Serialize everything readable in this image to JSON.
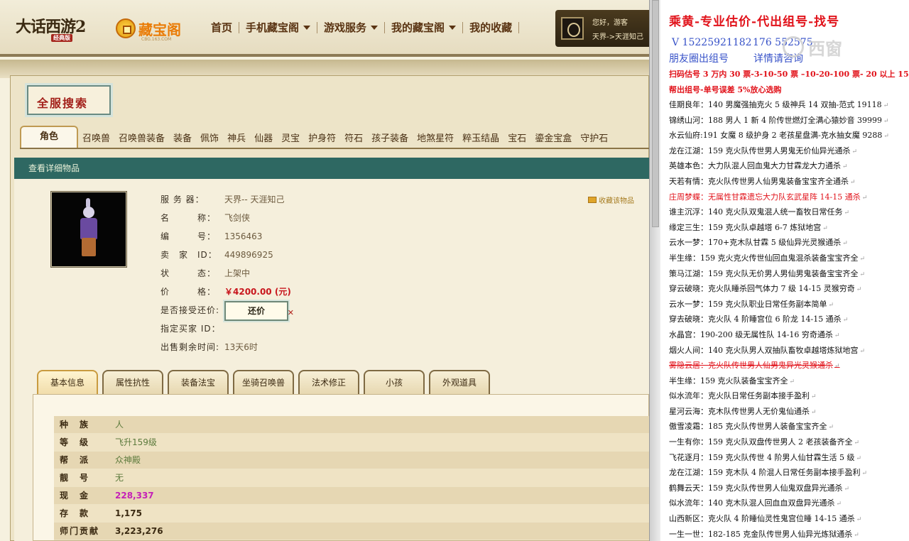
{
  "topbar": {
    "game_logo": "大话西游2",
    "game_logo_sub": "经典版",
    "site_logo": "藏宝阁",
    "site_logo_sub": "CBG.163.COM",
    "nav": [
      {
        "label": "首页",
        "dropdown": false
      },
      {
        "label": "手机藏宝阁",
        "dropdown": true
      },
      {
        "label": "游戏服务",
        "dropdown": true
      },
      {
        "label": "我的藏宝阁",
        "dropdown": true
      },
      {
        "label": "我的收藏",
        "dropdown": false
      }
    ],
    "user_greeting": "您好，游客",
    "user_server": "天界->天涯知己"
  },
  "search_badge": "全服搜索",
  "tabs": [
    "角色",
    "召唤兽",
    "召唤兽装备",
    "装备",
    "佩饰",
    "神兵",
    "仙器",
    "灵宝",
    "护身符",
    "符石",
    "孩子装备",
    "地煞星符",
    "粹玉结晶",
    "宝石",
    "鎏金宝盒",
    "守护石"
  ],
  "detail_bar": "查看详细物品",
  "item": {
    "fields": [
      {
        "label": "服 务 器：",
        "value": "天界-- 天涯知己"
      },
      {
        "label": "名　　　称：",
        "value": "飞剑侠"
      },
      {
        "label": "编　　　号：",
        "value": "1356463"
      },
      {
        "label": "卖　家　ID：",
        "value": "449896925"
      },
      {
        "label": "状　　　态：",
        "value": "上架中"
      },
      {
        "label": "价　　　格：",
        "value": "￥4200.00 (元)"
      },
      {
        "label": "是否接受还价:",
        "value": ""
      },
      {
        "label": "指定买家 ID：",
        "value": ""
      },
      {
        "label": "出售剩余时间:",
        "value": "13天6时"
      }
    ],
    "bargain_button": "还价",
    "favorite_link": "收藏该物品"
  },
  "subtabs": [
    "基本信息",
    "属性抗性",
    "装备法宝",
    "坐骑召唤兽",
    "法术修正",
    "小孩",
    "外观道具"
  ],
  "info_rows": [
    {
      "key": "种　族",
      "value": "人",
      "style": "green"
    },
    {
      "key": "等　级",
      "value": "飞升159级",
      "style": "green"
    },
    {
      "key": "帮　派",
      "value": "众神殿",
      "style": "green"
    },
    {
      "key": "靓　号",
      "value": "无",
      "style": "green"
    },
    {
      "key": "现　金",
      "value": "228,337",
      "style": "magenta"
    },
    {
      "key": "存　款",
      "value": "1,175",
      "style": "dark"
    },
    {
      "key": "师门贡献",
      "value": "3,223,276",
      "style": "dark"
    }
  ],
  "right_panel": {
    "title": "乘黄-专业估价-代出组号-找号",
    "phone": "V 15225921182",
    "phone2": "176  552575",
    "friends": "朋友圈出组号",
    "friends2": "详情请咨询",
    "watermark": "西窗",
    "note1": "扫码估号 3 万内 30 票-3-10-50 票 –10-20-100 票- 20 以上 150",
    "note2": "帮出组号-单号误差 5%放心选购",
    "list": [
      {
        "text": "佳期良年：140 男魔强抽克火 5 级神兵 14 双抽-范式 19118",
        "style": "normal"
      },
      {
        "text": "锦绣山河：188 男人 1 新 4 阶传世燃灯全满心猿妙音 39999",
        "style": "normal"
      },
      {
        "text": "水云仙府:191 女魔 8 级护身 2 老孩星盘满-克水抽女魔 9288",
        "style": "normal"
      },
      {
        "text": "龙在江湖：159 克火队传世男人男鬼无价仙异光通杀",
        "style": "normal"
      },
      {
        "text": "英雄本色：大力队混人回血鬼大力甘霖龙大力通杀",
        "style": "normal"
      },
      {
        "text": "天若有情：克火队传世男人仙男鬼装备宝宝齐全通杀",
        "style": "normal"
      },
      {
        "text": "庄周梦蝶：无属性甘霖遗忘大力队玄武星阵 14-15 通杀",
        "style": "red"
      },
      {
        "text": "谁主沉浮：140 克火队双鬼混人统一畜牧日常任务",
        "style": "normal"
      },
      {
        "text": "缘定三生：159 克火队卓越塔 6-7 炼狱地宫",
        "style": "normal"
      },
      {
        "text": "云水一梦：170+克木队甘霖 5 级仙异光灵猴通杀",
        "style": "normal"
      },
      {
        "text": "半生缘：159 克火克火传世仙回血鬼混杀装备宝宝齐全",
        "style": "normal"
      },
      {
        "text": "策马江湖：159 克火队无价男人男仙男鬼装备宝宝齐全",
        "style": "normal"
      },
      {
        "text": "穿云破晓：克火队睡杀回气体力 7 级 14-15 灵猴穷奇",
        "style": "normal"
      },
      {
        "text": "云水一梦：159 克火队职业日常任务副本简单",
        "style": "normal"
      },
      {
        "text": "穿去破晓：克火队 4 阶睡宫位 6 阶龙 14-15 通杀",
        "style": "normal"
      },
      {
        "text": "水晶宫：190-200 级无属性队 14-16 穷奇通杀",
        "style": "normal"
      },
      {
        "text": "烟火人间：140 克火队男人双抽队畜牧卓越塔炼狱地宫",
        "style": "normal"
      },
      {
        "text": "雾隐云居：克火队传世男人仙男鬼异光灵猴通杀",
        "style": "redline"
      },
      {
        "text": "半生缘：159 克火队装备宝宝齐全",
        "style": "normal"
      },
      {
        "text": "似水流年：克火队日常任务副本接手盈利",
        "style": "normal"
      },
      {
        "text": "星河云海：克木队传世男人无价鬼仙通杀",
        "style": "normal"
      },
      {
        "text": "傲雪凌霜：185 克火队传世男人装备宝宝齐全",
        "style": "normal"
      },
      {
        "text": "一生有你：159 克火队双盘传世男人 2 老孩装备齐全",
        "style": "normal"
      },
      {
        "text": "飞花逐月：159 克火队传世 4 阶男人仙甘霖生活 5 级",
        "style": "normal"
      },
      {
        "text": "龙在江湖：159 克木队 4 阶混人日常任务副本接手盈利",
        "style": "normal"
      },
      {
        "text": "鹤舞云天：159 克火队传世男人仙鬼双盘异光通杀",
        "style": "normal"
      },
      {
        "text": "似水流年：140 克木队混人回血血双盘异光通杀",
        "style": "normal"
      },
      {
        "text": "山西新区：克火队 4 阶睡仙灵性鬼宫位睡 14-15 通杀",
        "style": "normal"
      },
      {
        "text": "一生一世：182-185 克金队传世男人仙异光炼狱通杀",
        "style": "normal"
      }
    ]
  }
}
